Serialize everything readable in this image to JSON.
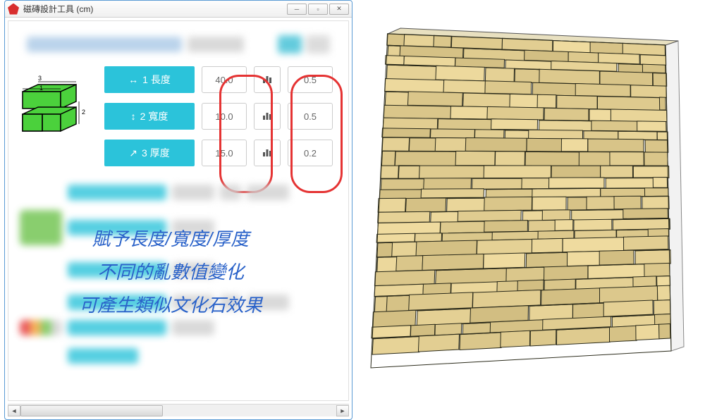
{
  "window": {
    "title": "磁磚設計工具 (cm)"
  },
  "params": {
    "row1": {
      "label": "1 長度",
      "value": "40.0",
      "variance": "0.5",
      "icon": "↔"
    },
    "row2": {
      "label": "2 寬度",
      "value": "10.0",
      "variance": "0.5",
      "icon": "↕"
    },
    "row3": {
      "label": "3 厚度",
      "value": "15.0",
      "variance": "0.2",
      "icon": "↗"
    }
  },
  "diagram_labels": {
    "a": "1",
    "b": "2",
    "c": "3"
  },
  "overlay": {
    "line1": "賦予長度/寬度/厚度",
    "line2": "不同的亂數值變化",
    "line3": "可產生類似文化石效果"
  }
}
